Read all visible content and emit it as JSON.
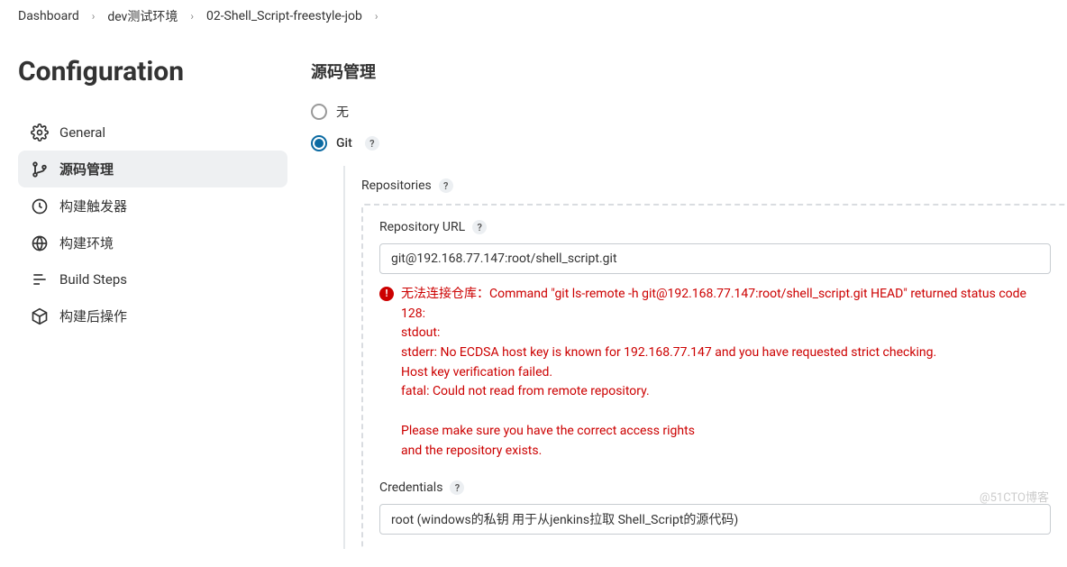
{
  "breadcrumb": {
    "items": [
      "Dashboard",
      "dev测试环境",
      "02-Shell_Script-freestyle-job"
    ]
  },
  "page_title": "Configuration",
  "sidebar": {
    "items": [
      {
        "label": "General"
      },
      {
        "label": "源码管理"
      },
      {
        "label": "构建触发器"
      },
      {
        "label": "构建环境"
      },
      {
        "label": "Build Steps"
      },
      {
        "label": "构建后操作"
      }
    ]
  },
  "section": {
    "title": "源码管理"
  },
  "scm": {
    "none_label": "无",
    "git_label": "Git",
    "repositories_label": "Repositories",
    "repo_url_label": "Repository URL",
    "repo_url_value": "git@192.168.77.147:root/shell_script.git",
    "error_text": "无法连接仓库：Command \"git ls-remote -h git@192.168.77.147:root/shell_script.git HEAD\" returned status code 128:\nstdout:\nstderr: No ECDSA host key is known for 192.168.77.147 and you have requested strict checking.\nHost key verification failed.\nfatal: Could not read from remote repository.\n\nPlease make sure you have the correct access rights\nand the repository exists.",
    "credentials_label": "Credentials",
    "credentials_value": "root (windows的私钥 用于从jenkins拉取 Shell_Script的源代码)"
  },
  "watermark": "@51CTO博客"
}
